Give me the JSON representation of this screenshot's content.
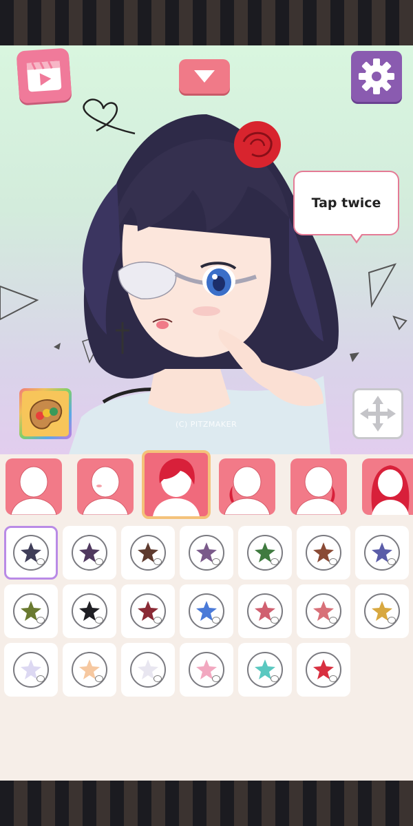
{
  "bubble": {
    "text": "Tap twice"
  },
  "watermark": "(C) PITZMAKER",
  "icons": {
    "video": "video-clip-icon",
    "dropdown": "chevron-down-icon",
    "settings": "gear-icon",
    "palette": "palette-icon",
    "move": "move-arrows-icon"
  },
  "category_tabs": [
    {
      "name": "face-base",
      "selected": false
    },
    {
      "name": "face-blush",
      "selected": false
    },
    {
      "name": "hair-short",
      "selected": true
    },
    {
      "name": "hair-side",
      "selected": false
    },
    {
      "name": "hair-side-left",
      "selected": false
    },
    {
      "name": "hair-long",
      "selected": false
    }
  ],
  "colors": [
    {
      "hex": "#3f3d58",
      "selected": true
    },
    {
      "hex": "#50395f"
    },
    {
      "hex": "#5e3a2e"
    },
    {
      "hex": "#7a5a8a"
    },
    {
      "hex": "#3f7a3f"
    },
    {
      "hex": "#8a4a35"
    },
    {
      "hex": "#5a5ca8"
    },
    {
      "hex": "#6a7a30"
    },
    {
      "hex": "#1f1f24"
    },
    {
      "hex": "#8a2a35"
    },
    {
      "hex": "#4a7ad8"
    },
    {
      "hex": "#d06070"
    },
    {
      "hex": "#d87078"
    },
    {
      "hex": "#d8a840"
    },
    {
      "hex": "#dcd8f2"
    },
    {
      "hex": "#f6c8a0"
    },
    {
      "hex": "#e8e6f0"
    },
    {
      "hex": "#f2a8c0"
    },
    {
      "hex": "#5ac8c0"
    },
    {
      "hex": "#d83040"
    }
  ]
}
